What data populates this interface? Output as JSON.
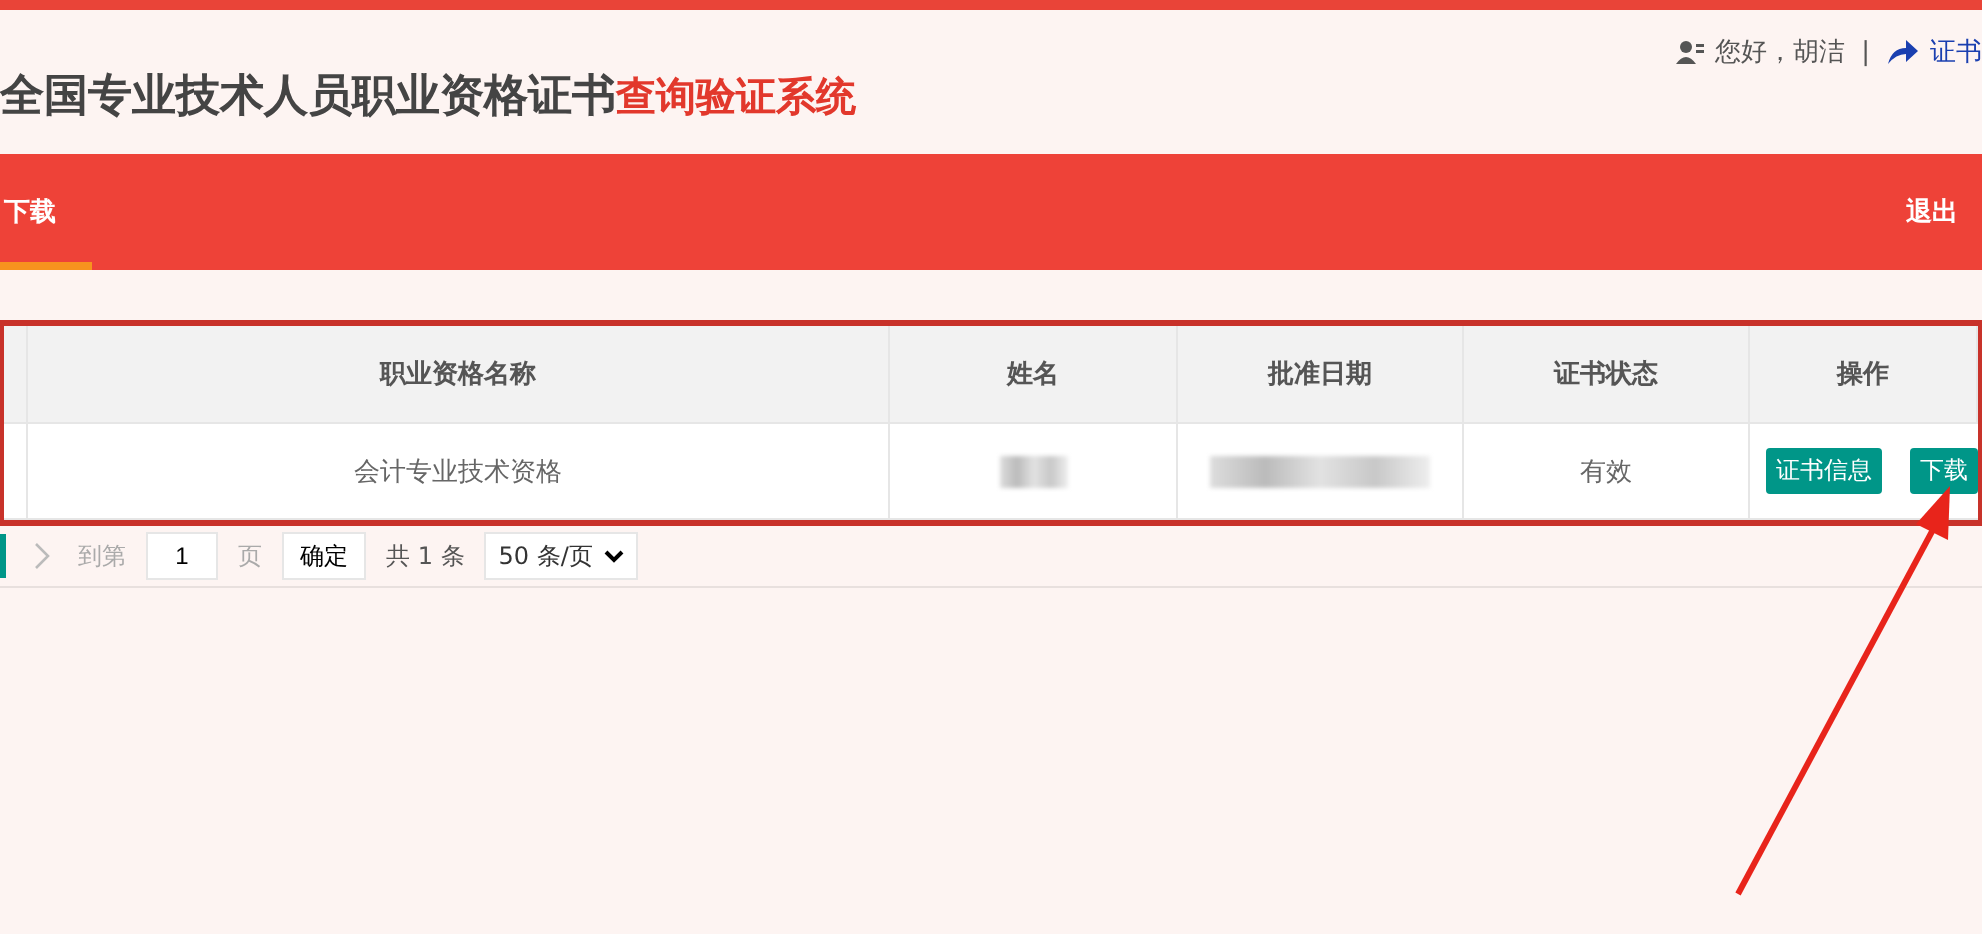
{
  "header": {
    "title": "全国专业技术人员职业资格证书",
    "title_highlight": "查询验证系统",
    "greeting": "您好，胡洁",
    "separator": "|",
    "link": "证书"
  },
  "nav": {
    "items": [
      {
        "label": "下载",
        "selected": true
      }
    ],
    "logout": "退出"
  },
  "table": {
    "columns": [
      "职业资格名称",
      "姓名",
      "批准日期",
      "证书状态",
      "操作"
    ],
    "rows": [
      {
        "qualification": "会计专业技术资格",
        "status": "有效",
        "actions": [
          "证书信息",
          "下载"
        ]
      }
    ]
  },
  "pagination": {
    "goto_label": "到第",
    "page": "1",
    "page_unit": "页",
    "confirm": "确定",
    "total": "共 1 条",
    "page_size": "50 条/页"
  }
}
